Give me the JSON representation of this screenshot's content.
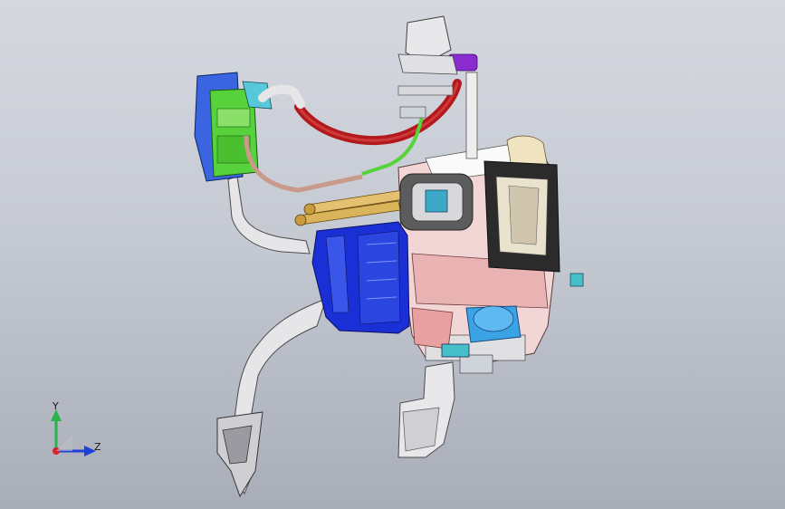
{
  "viewport": {
    "background_top": "#d5d8df",
    "background_bottom": "#a9adb8"
  },
  "triad": {
    "y_label": "Y",
    "z_label": "Z",
    "y_color": "#2bb24c",
    "z_color": "#1f3fd6",
    "x_color": "#d8232a"
  },
  "parts": {
    "blower_housing_color": "#1b2fd6",
    "evaporator_case_color": "#f0c9c9",
    "filter_frame_color": "#2a2a2a",
    "refrigerant_hose_color": "#b3191b",
    "receiver_drier_color": "#57d23c",
    "control_module_color": "#3a64e0",
    "motor_color": "#3aa3e6",
    "heater_pipe_color": "#d9b45a",
    "duct_color": "#e6e6e8",
    "valve_color": "#8a2bd0"
  }
}
